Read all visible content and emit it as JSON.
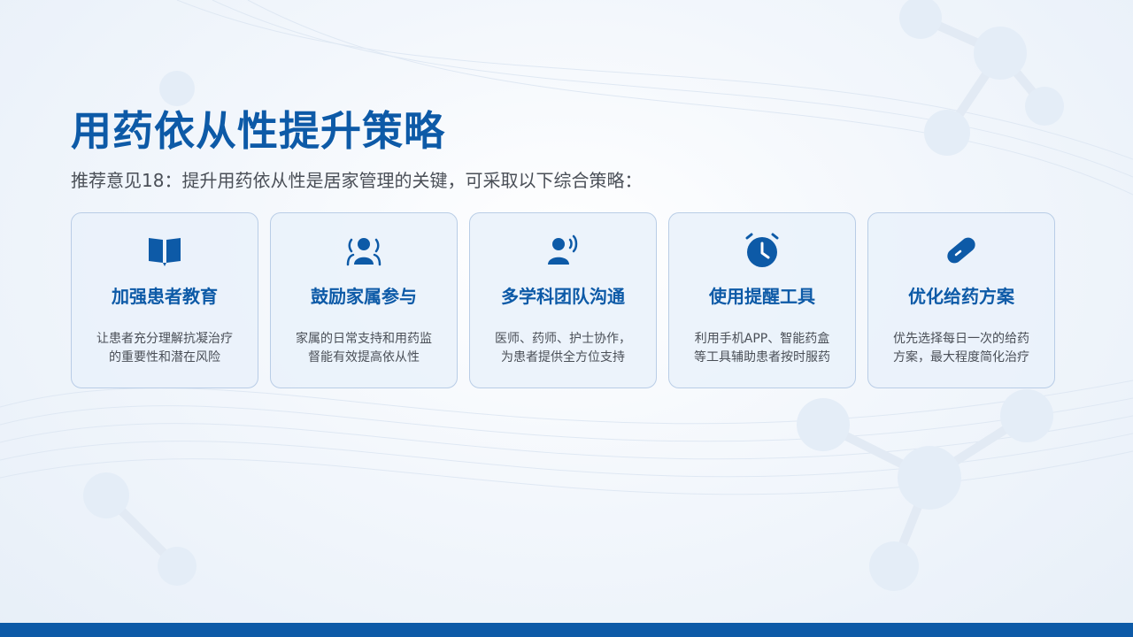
{
  "slide": {
    "title": "用药依从性提升策略",
    "subtitle": "推荐意见18：提升用药依从性是居家管理的关键，可采取以下综合策略：",
    "accent_color": "#0d5aa7",
    "cards": [
      {
        "icon": "book-icon",
        "title": "加强患者教育",
        "desc_line1": "让患者充分理解抗凝治疗",
        "desc_line2": "的重要性和潜在风险"
      },
      {
        "icon": "family-group-icon",
        "title": "鼓励家属参与",
        "desc_line1": "家属的日常支持和用药监",
        "desc_line2": "督能有效提高依从性"
      },
      {
        "icon": "speaker-person-icon",
        "title": "多学科团队沟通",
        "desc_line1": "医师、药师、护士协作，",
        "desc_line2": "为患者提供全方位支持"
      },
      {
        "icon": "alarm-clock-icon",
        "title": "使用提醒工具",
        "desc_line1": "利用手机APP、智能药盒",
        "desc_line2": "等工具辅助患者按时服药"
      },
      {
        "icon": "pill-capsule-icon",
        "title": "优化给药方案",
        "desc_line1": "优先选择每日一次的给药",
        "desc_line2": "方案，最大程度简化治疗"
      }
    ]
  }
}
